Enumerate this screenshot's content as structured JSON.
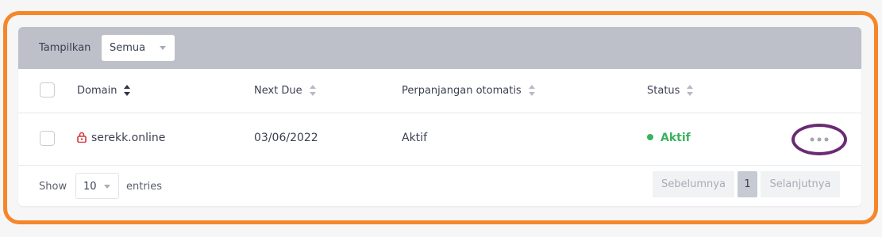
{
  "filter": {
    "label": "Tampilkan",
    "selected": "Semua"
  },
  "table": {
    "columns": [
      {
        "label": "Domain",
        "sort": "active"
      },
      {
        "label": "Next Due",
        "sort": "none"
      },
      {
        "label": "Perpanjangan otomatis",
        "sort": "none"
      },
      {
        "label": "Status",
        "sort": "none"
      }
    ],
    "rows": [
      {
        "domain": "serekk.online",
        "next_due": "03/06/2022",
        "auto_renew": "Aktif",
        "status": "Aktif",
        "domain_icon": "lock-icon",
        "actions_icon": "more-dots-icon"
      }
    ]
  },
  "footer": {
    "show_label": "Show",
    "page_size": "10",
    "entries_label": "entries",
    "prev_label": "Sebelumnya",
    "current_page": "1",
    "next_label": "Selanjutnya"
  },
  "colors": {
    "highlight_frame": "#f5872a",
    "action_circle": "#6a2a73",
    "status_active": "#3ab25e",
    "lock_icon": "#d23a3a",
    "filter_bar": "#bdc0c9"
  }
}
